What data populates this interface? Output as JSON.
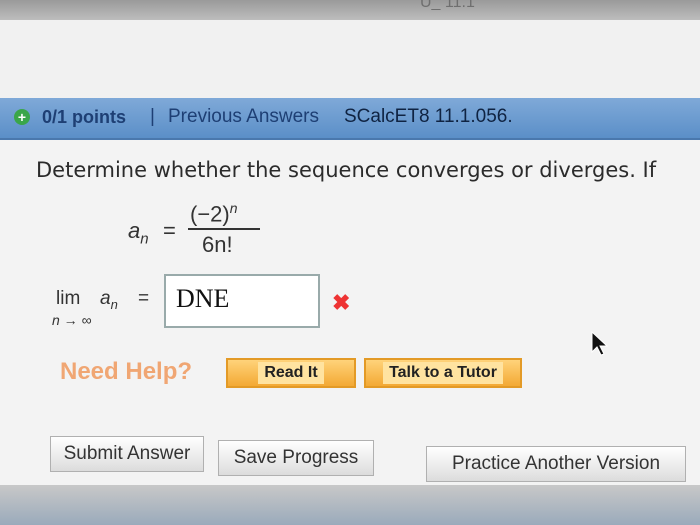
{
  "header_partial_text": "U_ 11.1",
  "question_header": {
    "points": "0/1 points",
    "separator": "|",
    "previous_answers": "Previous Answers",
    "code": "SCalcET8 11.1.056."
  },
  "question": {
    "text": "Determine whether the sequence converges or diverges. If",
    "formula": {
      "lhs": "a",
      "lhs_sub": "n",
      "equals": "=",
      "numerator": "(−2)",
      "numerator_exp": "n",
      "denominator": "6n!"
    },
    "limit": {
      "word": "lim",
      "subscript": "n → ∞",
      "term": "a",
      "term_sub": "n",
      "equals": "=",
      "answer_value": "DNE",
      "result_mark": "✖"
    }
  },
  "help": {
    "label": "Need Help?",
    "read_it": "Read It",
    "talk_tutor": "Talk to a Tutor"
  },
  "actions": {
    "submit": "Submit Answer",
    "save": "Save Progress",
    "practice": "Practice Another Version"
  },
  "colors": {
    "header_blue": "#6b9bd0",
    "need_help_orange": "#f0a673",
    "wrong_red": "#e33333"
  }
}
